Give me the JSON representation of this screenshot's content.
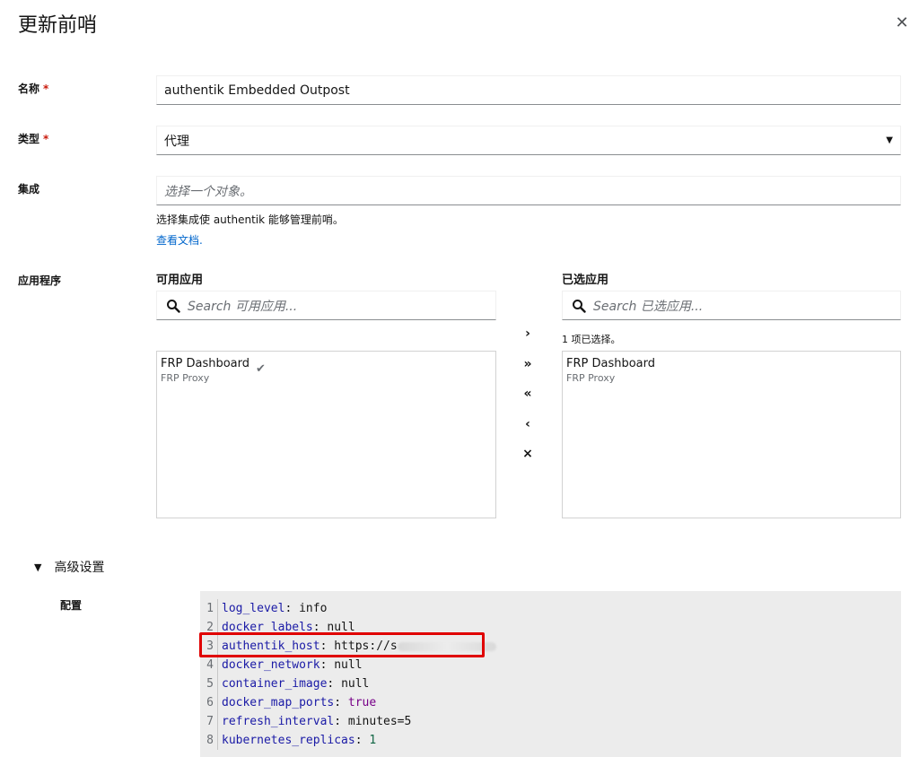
{
  "modal": {
    "title": "更新前哨"
  },
  "form": {
    "name": {
      "label": "名称",
      "required_mark": "*",
      "value": "authentik Embedded Outpost"
    },
    "type": {
      "label": "类型",
      "required_mark": "*",
      "value": "代理"
    },
    "integration": {
      "label": "集成",
      "placeholder": "选择一个对象。",
      "helper": "选择集成使 authentik 能够管理前哨。",
      "doc_link": "查看文档."
    },
    "applications": {
      "label": "应用程序",
      "available": {
        "title": "可用应用",
        "search_placeholder": "Search 可用应用...",
        "items": [
          {
            "title": "FRP Dashboard",
            "subtitle": "FRP Proxy",
            "selected": true
          }
        ]
      },
      "chosen": {
        "title": "已选应用",
        "search_placeholder": "Search 已选应用...",
        "status": "1 项已选择。",
        "items": [
          {
            "title": "FRP Dashboard",
            "subtitle": "FRP Proxy"
          }
        ]
      },
      "controls": {
        "add": "›",
        "add_all": "»",
        "remove_all": "«",
        "remove": "‹",
        "clear": "×"
      }
    }
  },
  "advanced": {
    "toggle_label": "高级设置",
    "config_label": "配置",
    "code_lines": [
      {
        "n": "1",
        "key": "log_level",
        "sep": ": ",
        "value": "info",
        "vtype": "plain"
      },
      {
        "n": "2",
        "key": "docker_labels",
        "sep": ": ",
        "value": "null",
        "vtype": "plain"
      },
      {
        "n": "3",
        "key": "authentik_host",
        "sep": ": ",
        "value": "https://s",
        "vtype": "plain"
      },
      {
        "n": "4",
        "key": "docker_network",
        "sep": ": ",
        "value": "null",
        "vtype": "plain"
      },
      {
        "n": "5",
        "key": "container_image",
        "sep": ": ",
        "value": "null",
        "vtype": "plain"
      },
      {
        "n": "6",
        "key": "docker_map_ports",
        "sep": ": ",
        "value": "true",
        "vtype": "bool"
      },
      {
        "n": "7",
        "key": "refresh_interval",
        "sep": ": ",
        "value": "minutes=5",
        "vtype": "plain"
      },
      {
        "n": "8",
        "key": "kubernetes_replicas",
        "sep": ": ",
        "value": "1",
        "vtype": "num"
      }
    ]
  },
  "icons": {
    "close": "close-icon",
    "caret": "caret-down-icon",
    "search": "search-icon",
    "check": "check-icon",
    "chevron": "chevron-down-icon"
  },
  "colors": {
    "required": "#c9190b",
    "link": "#0066cc",
    "highlight": "#e00000",
    "code_bg": "#ececec"
  }
}
